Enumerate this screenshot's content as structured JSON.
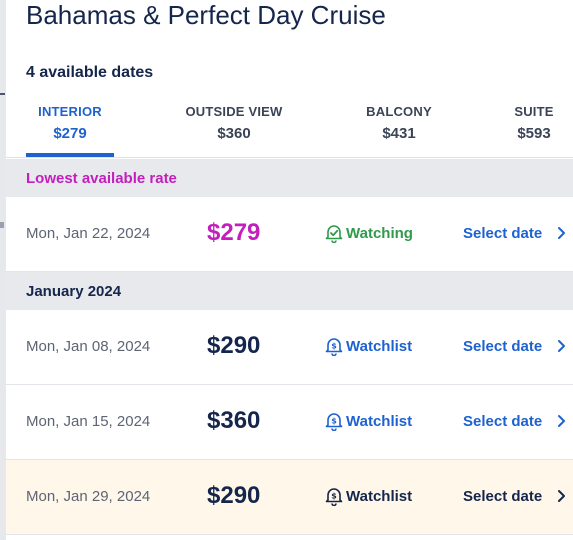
{
  "header": {
    "title": "Bahamas & Perfect Day Cruise",
    "available": "4 available dates"
  },
  "tabs": [
    {
      "label": "INTERIOR",
      "price": "$279",
      "active": true
    },
    {
      "label": "OUTSIDE VIEW",
      "price": "$360",
      "active": false
    },
    {
      "label": "BALCONY",
      "price": "$431",
      "active": false
    },
    {
      "label": "SUITE",
      "price": "$593",
      "active": false
    }
  ],
  "lowest": {
    "header": "Lowest available rate",
    "row": {
      "date": "Mon, Jan 22, 2024",
      "price": "$279",
      "watch": "Watching",
      "select": "Select date"
    }
  },
  "month": {
    "header": "January 2024",
    "rows": [
      {
        "date": "Mon, Jan 08, 2024",
        "price": "$290",
        "watch": "Watchlist",
        "select": "Select date"
      },
      {
        "date": "Mon, Jan 15, 2024",
        "price": "$360",
        "watch": "Watchlist",
        "select": "Select date"
      },
      {
        "date": "Mon, Jan 29, 2024",
        "price": "$290",
        "watch": "Watchlist",
        "select": "Select date"
      }
    ]
  },
  "colors": {
    "navy": "#15264c",
    "accent_blue": "#1e62d0",
    "magenta": "#c21fbe",
    "green": "#2f9a4b",
    "hover_row": "#fff8ea"
  },
  "icons": {
    "watching": "bell-check-icon",
    "watchlist": "bell-dollar-icon",
    "select": "chevron-right-icon"
  }
}
